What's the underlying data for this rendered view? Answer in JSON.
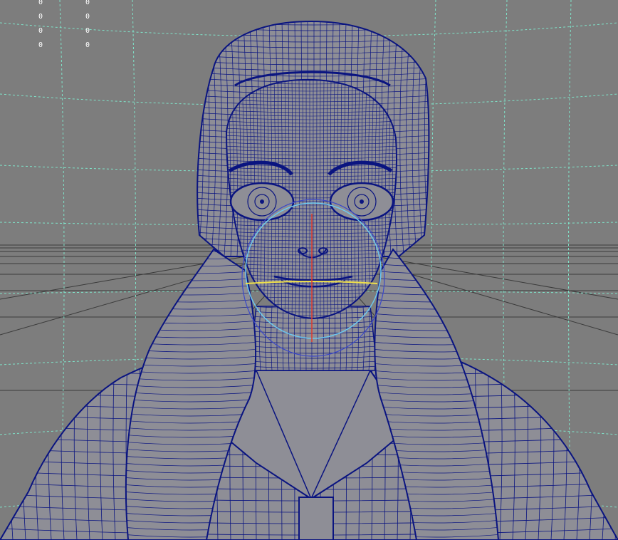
{
  "viewport": {
    "background": "#7d7d7d",
    "wire_color": "#0a1480",
    "mesh_fill": "#8e8e96",
    "guide_color": "#7fe3c9",
    "controller_color": "#6cc8f0",
    "accent_yellow": "#f0e14a",
    "accent_red": "#e03a2a"
  },
  "hud": {
    "col1": [
      "0",
      "0",
      "0",
      "0"
    ],
    "col2": [
      "0",
      "0",
      "0",
      "0"
    ]
  }
}
